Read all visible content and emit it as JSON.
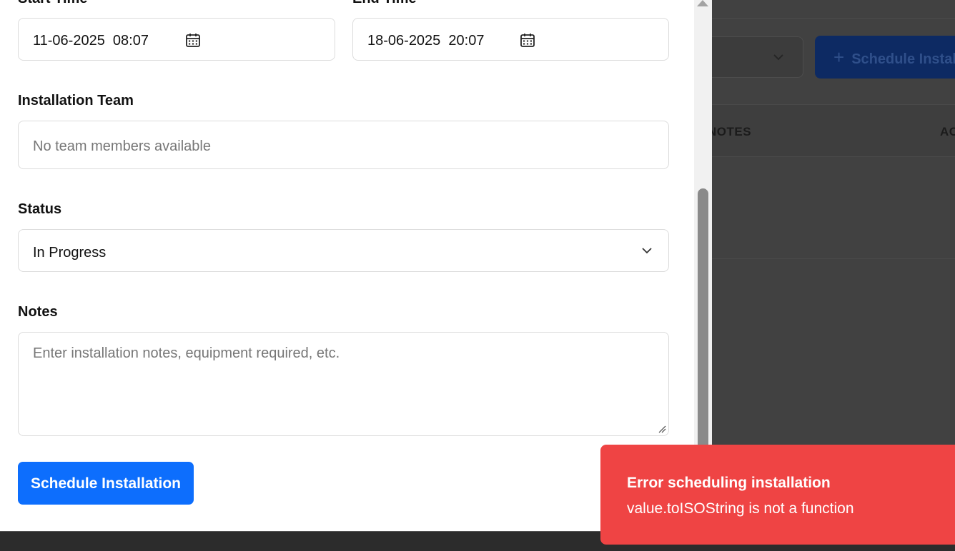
{
  "background": {
    "schedule_button_label": "Schedule Installation",
    "table_headers": [
      "NOTES",
      "ACTIONS"
    ]
  },
  "form": {
    "start_time": {
      "label": "Start Time",
      "value": "11-06-2025  08:07"
    },
    "end_time": {
      "label": "End Time",
      "value": "18-06-2025  20:07"
    },
    "installation_team": {
      "label": "Installation Team",
      "placeholder": "No team members available"
    },
    "status": {
      "label": "Status",
      "selected": "In Progress"
    },
    "notes": {
      "label": "Notes",
      "placeholder": "Enter installation notes, equipment required, etc."
    },
    "submit_label": "Schedule Installation"
  },
  "toast": {
    "title": "Error scheduling installation",
    "message": "value.toISOString is not a function",
    "color": "#ef4444"
  },
  "colors": {
    "primary": "#0d6efd",
    "error": "#ef4444"
  }
}
